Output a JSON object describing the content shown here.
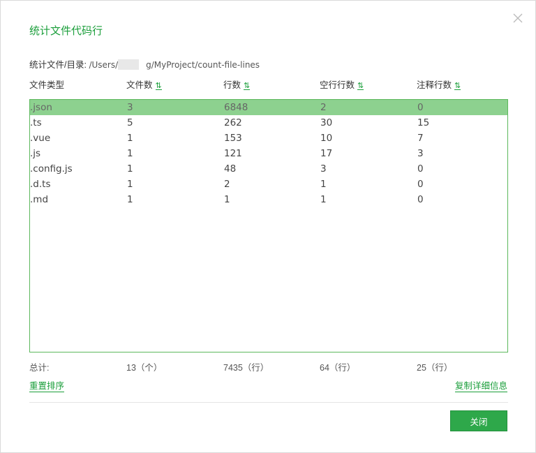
{
  "dialog": {
    "title": "统计文件代码行",
    "close_icon": "close-icon"
  },
  "path": {
    "label": "统计文件/目录:",
    "prefix": "/Users/",
    "suffix": "g/MyProject/count-file-lines"
  },
  "table": {
    "headers": [
      "文件类型",
      "文件数",
      "行数",
      "空行行数",
      "注释行数"
    ],
    "sortable": [
      false,
      true,
      true,
      true,
      true
    ],
    "sort_icon": "⇅",
    "rows": [
      [
        ".json",
        "3",
        "6848",
        "2",
        "0"
      ],
      [
        ".ts",
        "5",
        "262",
        "30",
        "15"
      ],
      [
        ".vue",
        "1",
        "153",
        "10",
        "7"
      ],
      [
        ".js",
        "1",
        "121",
        "17",
        "3"
      ],
      [
        ".config.js",
        "1",
        "48",
        "3",
        "0"
      ],
      [
        ".d.ts",
        "1",
        "2",
        "1",
        "0"
      ],
      [
        ".md",
        "1",
        "1",
        "1",
        "0"
      ]
    ],
    "selected_row": 0
  },
  "totals": {
    "label": "总计:",
    "files": "13（个）",
    "lines": "7435（行）",
    "blank": "64（行）",
    "comment": "25（行）"
  },
  "actions": {
    "reset_sort": "重置排序",
    "copy_details": "复制详细信息",
    "close": "关闭"
  },
  "colors": {
    "accent": "#1a9e3a",
    "selected_row": "#8dd18f",
    "button": "#2ea84a"
  }
}
